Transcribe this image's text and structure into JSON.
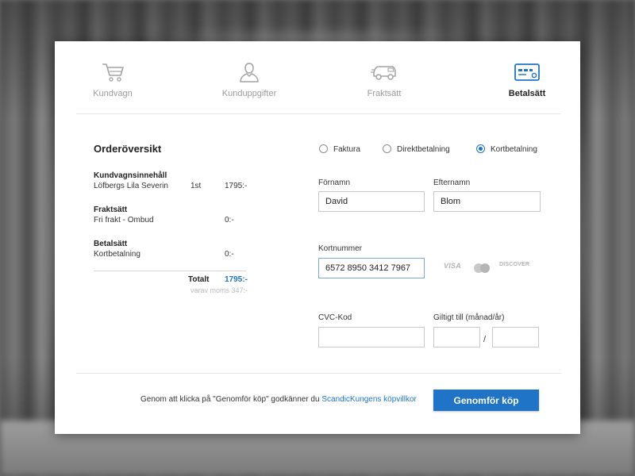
{
  "steps": [
    {
      "label": "Kundvagn",
      "icon": "cart-icon",
      "active": false
    },
    {
      "label": "Kunduppgifter",
      "icon": "user-icon",
      "active": false
    },
    {
      "label": "Fraktsätt",
      "icon": "truck-icon",
      "active": false
    },
    {
      "label": "Betalsätt",
      "icon": "credit-card-icon",
      "active": true
    }
  ],
  "overview": {
    "title": "Orderöversikt",
    "sections": [
      {
        "heading": "Kundvagnsinnehåll",
        "name": "Löfbergs Lila Severin",
        "qty": "1st",
        "price": "1795:-"
      },
      {
        "heading": "Fraktsätt",
        "name": "Fri frakt - Ombud",
        "qty": "",
        "price": "0:-"
      },
      {
        "heading": "Betalsätt",
        "name": "Kortbetalning",
        "qty": "",
        "price": "0:-"
      }
    ],
    "total_label": "Totalt",
    "total_value": "1795:-",
    "vat_note": "varav moms 347:-"
  },
  "payment_methods": [
    {
      "label": "Faktura",
      "checked": false
    },
    {
      "label": "Direktbetalning",
      "checked": false
    },
    {
      "label": "Kortbetalning",
      "checked": true
    }
  ],
  "form": {
    "first_name_label": "Förnamn",
    "first_name_value": "David",
    "last_name_label": "Efternamn",
    "last_name_value": "Blom",
    "card_number_label": "Kortnummer",
    "card_number_value": "6572 8950 3412 7967",
    "cvc_label": "CVC-Kod",
    "cvc_value": "",
    "valid_until_label": "Giltigt till (månad/år)",
    "month_value": "",
    "year_value": "",
    "separator": "/"
  },
  "card_brands": [
    "VISA",
    "mastercard",
    "DISCOVER"
  ],
  "footer": {
    "terms_text": "Genom att klicka på \"Genomför köp\" godkänner du ",
    "terms_link": "ScandicKungens köpvillkor",
    "buy_label": "Genomför köp"
  },
  "colors": {
    "accent": "#1f74c8"
  }
}
